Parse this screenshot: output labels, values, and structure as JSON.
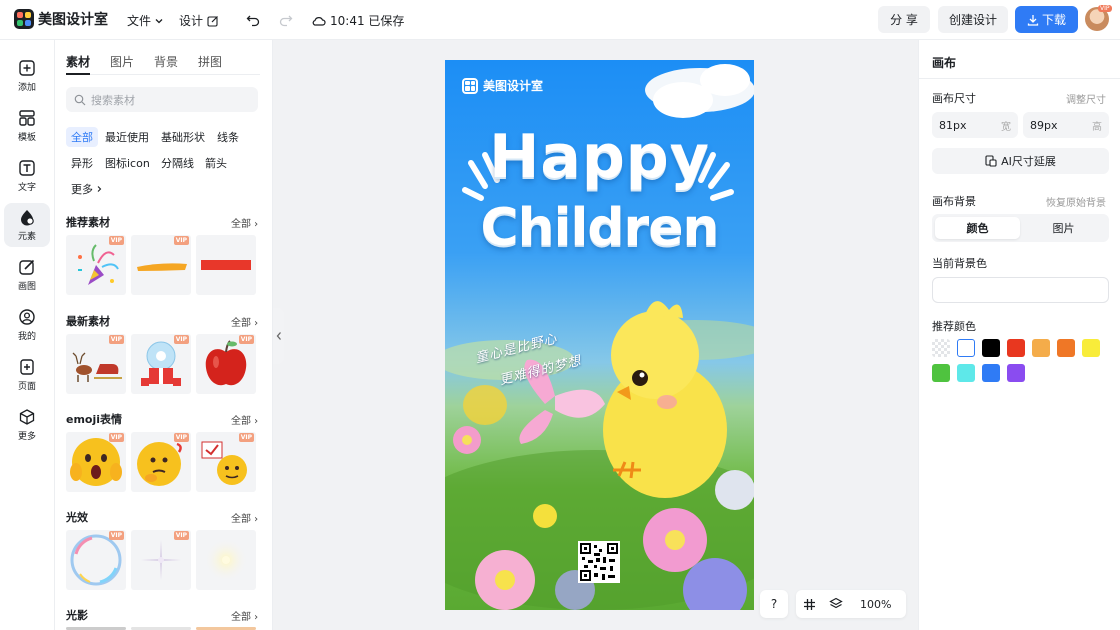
{
  "app": {
    "name": "美图设计室",
    "save_status": "10:41 已保存"
  },
  "topbar": {
    "menu_file": "文件",
    "menu_design": "设计",
    "share": "分 享",
    "create": "创建设计",
    "download": "下载",
    "avatar_badge": "VIP"
  },
  "leftnav": [
    {
      "label": "添加",
      "icon": "plus-square-icon"
    },
    {
      "label": "模板",
      "icon": "template-icon"
    },
    {
      "label": "文字",
      "icon": "text-icon"
    },
    {
      "label": "元素",
      "icon": "elements-icon"
    },
    {
      "label": "画图",
      "icon": "draw-icon"
    },
    {
      "label": "我的",
      "icon": "user-icon"
    },
    {
      "label": "页面",
      "icon": "page-add-icon"
    },
    {
      "label": "更多",
      "icon": "cube-icon"
    }
  ],
  "materials": {
    "tabs": [
      "素材",
      "图片",
      "背景",
      "拼图"
    ],
    "search_placeholder": "搜索素材",
    "chips": [
      "全部",
      "最近使用",
      "基础形状",
      "线条",
      "异形",
      "图标icon",
      "分隔线",
      "箭头",
      "更多"
    ],
    "see_all": "全部",
    "vip_label": "VIP",
    "sections": [
      {
        "title": "推荐素材"
      },
      {
        "title": "最新素材"
      },
      {
        "title": "emoji表情"
      },
      {
        "title": "光效"
      },
      {
        "title": "光影"
      }
    ]
  },
  "poster": {
    "brand": "美图设计室",
    "line1": "Happy",
    "line2": "Children",
    "cn_line1": "童心是比野心",
    "cn_line2": "更难得的梦想"
  },
  "canvas_controls": {
    "help": "?",
    "zoom": "100%"
  },
  "right": {
    "title": "画布",
    "size_label": "画布尺寸",
    "size_hint": "调整尺寸",
    "width_value": "81px",
    "width_unit": "宽",
    "height_value": "89px",
    "height_unit": "高",
    "ai_button": "AI尺寸延展",
    "bg_label": "画布背景",
    "bg_hint": "恢复原始背景",
    "seg_color": "颜色",
    "seg_image": "图片",
    "current_bg_label": "当前背景色",
    "recommend_label": "推荐颜色",
    "colors": [
      "transparent",
      "#ffffff",
      "#000000",
      "#e8371f",
      "#f4ac4a",
      "#ef7726",
      "#f8ec3a",
      "#4fc33f",
      "#5ee8e9",
      "#2f7bf5",
      "#8a4cf0"
    ]
  }
}
